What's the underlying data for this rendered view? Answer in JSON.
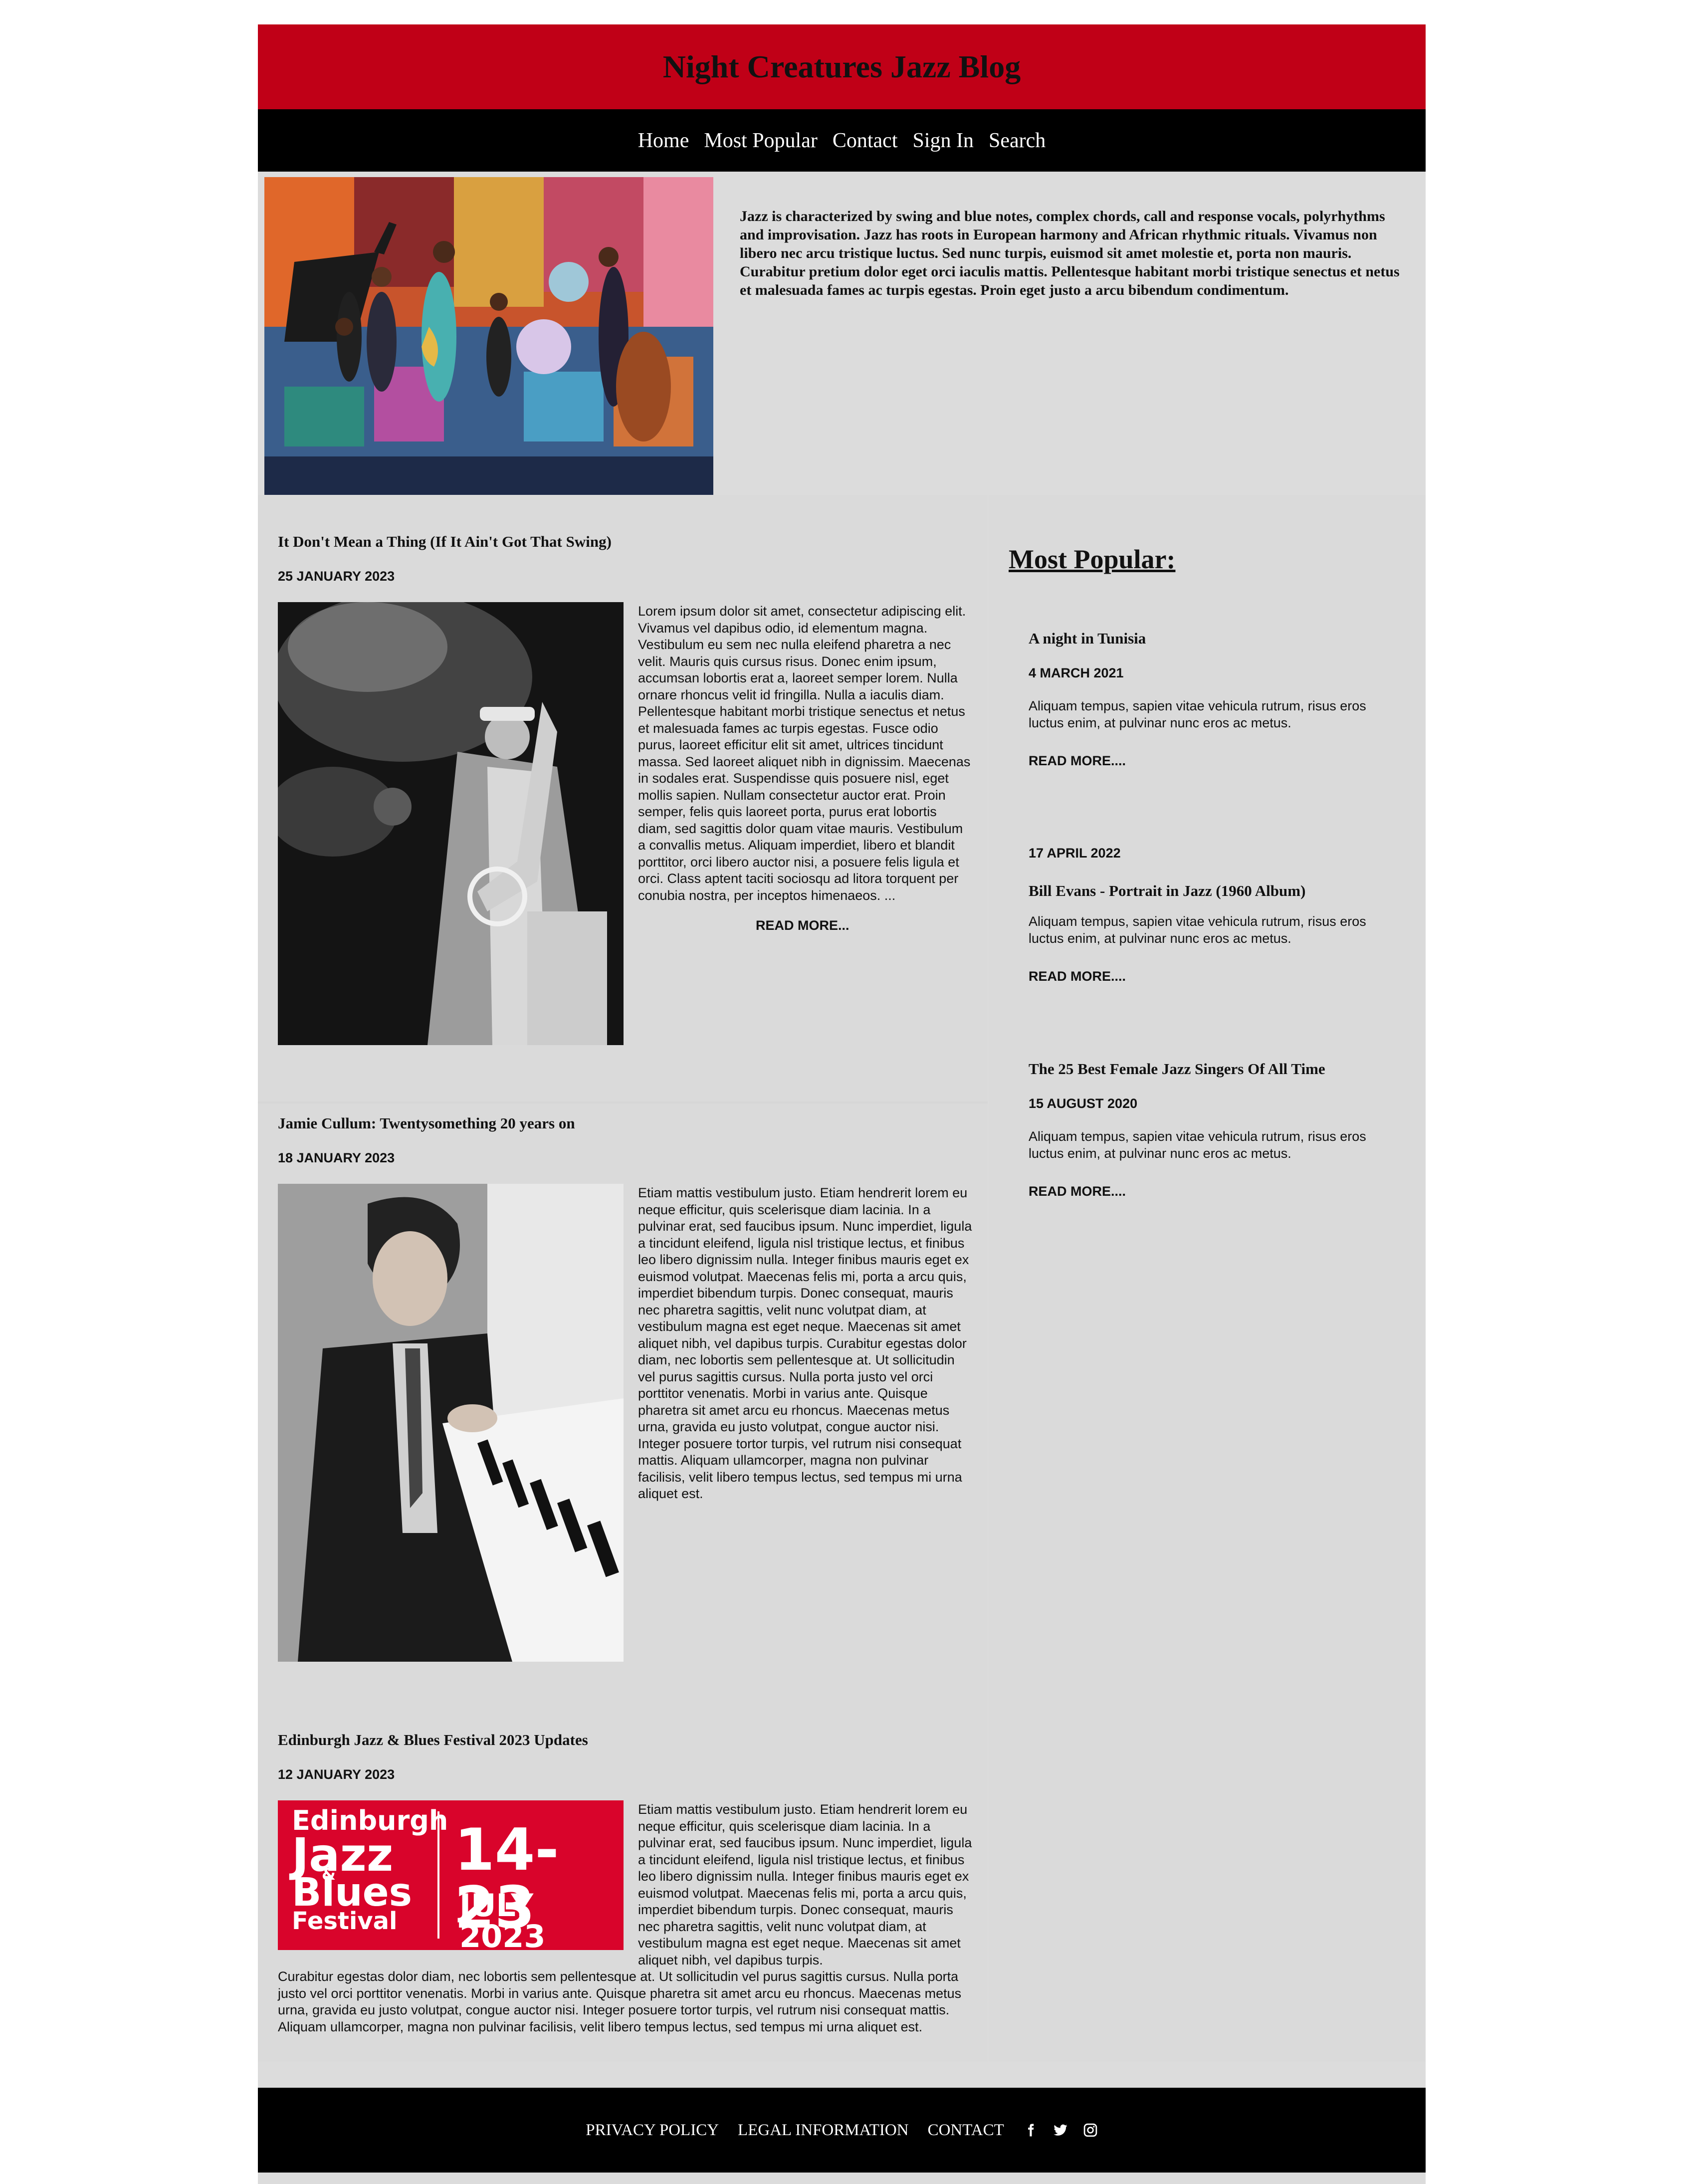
{
  "header": {
    "title": "Night Creatures Jazz Blog"
  },
  "nav": {
    "items": [
      "Home",
      "Most Popular",
      "Contact",
      "Sign In",
      "Search"
    ]
  },
  "hero": {
    "text": "Jazz is characterized by swing and blue notes, complex chords, call and response vocals, polyrhythms and improvisation. Jazz has roots in European harmony and African rhythmic rituals. Vivamus non libero nec arcu tristique luctus. Sed nunc turpis, euismod sit amet molestie et, porta non mauris. Curabitur pretium dolor eget orci iaculis mattis. Pellentesque habitant morbi tristique senectus et netus et malesuada fames ac turpis egestas. Proin eget justo a arcu bibendum condimentum."
  },
  "posts": [
    {
      "title": "It Don't Mean a Thing (If It Ain't Got That Swing)",
      "date": "25 JANUARY 2023",
      "body": "Lorem ipsum dolor sit amet, consectetur adipiscing elit. Vivamus vel dapibus odio, id elementum magna. Vestibulum eu sem nec nulla eleifend pharetra a nec velit. Mauris quis cursus risus. Donec enim ipsum, accumsan lobortis erat a, laoreet semper lorem. Nulla ornare rhoncus velit id fringilla. Nulla a iaculis diam. Pellentesque habitant morbi tristique senectus et netus et malesuada fames ac turpis egestas. Fusce odio purus, laoreet efficitur elit sit amet, ultrices tincidunt massa. Sed laoreet aliquet nibh in dignissim. Maecenas in sodales erat. Suspendisse quis posuere nisl, eget mollis sapien. Nullam consectetur auctor erat. Proin semper, felis quis laoreet porta, purus erat lobortis diam, sed sagittis dolor quam vitae mauris. Vestibulum a convallis metus. Aliquam imperdiet, libero et blandit porttitor, orci libero auctor nisi, a posuere felis ligula et orci. Class aptent taciti sociosqu ad litora torquent per conubia nostra, per inceptos himenaeos. ...",
      "read_more": "READ MORE..."
    },
    {
      "title": "Jamie Cullum: Twentysomething 20 years on",
      "date": "18 JANUARY 2023",
      "body": "Etiam mattis vestibulum justo. Etiam hendrerit lorem eu neque efficitur, quis scelerisque diam lacinia. In a pulvinar erat, sed faucibus ipsum. Nunc imperdiet, ligula a tincidunt eleifend, ligula nisl tristique lectus, et finibus leo libero dignissim nulla. Integer finibus mauris eget ex euismod volutpat. Maecenas felis mi, porta a arcu quis, imperdiet bibendum turpis. Donec consequat, mauris nec pharetra sagittis, velit nunc volutpat diam, at vestibulum magna est eget neque. Maecenas sit amet aliquet nibh, vel dapibus turpis. Curabitur egestas dolor diam, nec lobortis sem pellentesque at. Ut sollicitudin vel purus sagittis cursus. Nulla porta justo vel orci porttitor venenatis. Morbi in varius ante. Quisque pharetra sit amet arcu eu rhoncus. Maecenas metus urna, gravida eu justo volutpat, congue auctor nisi. Integer posuere tortor turpis, vel rutrum nisi consequat mattis. Aliquam ullamcorper, magna non pulvinar facilisis, velit libero tempus lectus, sed tempus mi urna aliquet est."
    },
    {
      "title": "Edinburgh Jazz & Blues Festival 2023 Updates",
      "date": "12 JANUARY 2023",
      "body": "Etiam mattis vestibulum justo. Etiam hendrerit lorem eu neque efficitur, quis scelerisque diam lacinia. In a pulvinar erat, sed faucibus ipsum. Nunc imperdiet, ligula a tincidunt eleifend, ligula nisl tristique lectus, et finibus leo libero dignissim nulla. Integer finibus mauris eget ex euismod volutpat. Maecenas felis mi, porta a arcu quis, imperdiet bibendum turpis. Donec consequat, mauris nec pharetra sagittis, velit nunc volutpat diam, at vestibulum magna est eget neque. Maecenas sit amet aliquet nibh, vel dapibus turpis.",
      "body_continued": "Curabitur egestas dolor diam, nec lobortis sem pellentesque at. Ut sollicitudin vel purus sagittis cursus. Nulla porta justo vel orci porttitor venenatis. Morbi in varius ante. Quisque pharetra sit amet arcu eu rhoncus. Maecenas metus urna, gravida eu justo volutpat, congue auctor nisi. Integer posuere tortor turpis, vel rutrum nisi consequat mattis. Aliquam ullamcorper, magna non pulvinar facilisis, velit libero tempus lectus, sed tempus mi urna aliquet est.",
      "banner": {
        "line1": "Edinburgh",
        "line2": "Jazz",
        "line3": "&",
        "line4": "Blues",
        "line5": "Festival",
        "dates": "14-23",
        "month": "JULY 2023"
      }
    }
  ],
  "sidebar": {
    "heading": "Most Popular:",
    "items": [
      {
        "title": "A night in Tunisia",
        "date": "4 MARCH 2021",
        "text": "Aliquam tempus, sapien vitae vehicula rutrum, risus eros luctus enim, at pulvinar nunc eros ac metus.",
        "read_more": "READ MORE...."
      },
      {
        "title": "Bill Evans - Portrait in Jazz (1960 Album)",
        "date": "17 APRIL 2022",
        "text": "Aliquam tempus, sapien vitae vehicula rutrum, risus eros luctus enim, at pulvinar nunc eros ac metus.",
        "read_more": "READ MORE...."
      },
      {
        "title": "The 25 Best Female Jazz Singers Of All Time",
        "date": "15 AUGUST 2020",
        "text": "Aliquam tempus, sapien vitae vehicula rutrum, risus eros luctus enim, at pulvinar nunc eros ac metus.",
        "read_more": "READ MORE...."
      }
    ]
  },
  "footer": {
    "links": [
      "PRIVACY POLICY",
      "LEGAL INFORMATION",
      "CONTACT"
    ],
    "social_icons": [
      "facebook-icon",
      "twitter-icon",
      "instagram-icon"
    ]
  },
  "colors": {
    "header_red": "#c00017",
    "nav_black": "#000000",
    "content_grey": "#dcdcdc",
    "banner_red": "#d9042b"
  }
}
